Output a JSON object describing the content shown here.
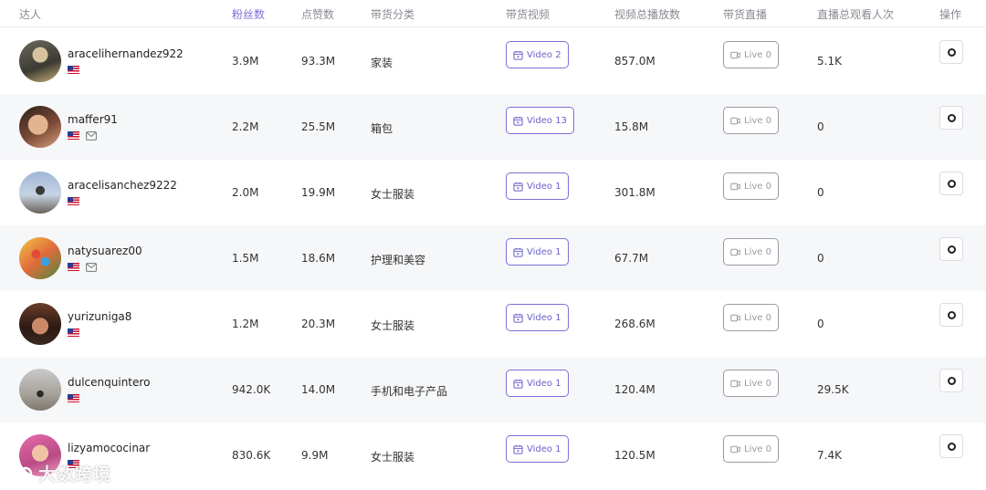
{
  "header": {
    "col_creator": "达人",
    "col_followers": "粉丝数",
    "col_likes": "点赞数",
    "col_category": "带货分类",
    "col_videos": "带货视频",
    "col_video_views": "视频总播放数",
    "col_live": "带货直播",
    "col_live_viewers": "直播总观看人次",
    "col_actions": "操作"
  },
  "colors": {
    "accent": "#7b6fd6",
    "alt_row": "#f6f7f9",
    "live_border": "#9a9aa4"
  },
  "rows": [
    {
      "username": "aracelihernandez922",
      "flag": "us-flag-icon",
      "has_mail": false,
      "followers": "3.9M",
      "likes": "93.3M",
      "category": "家装",
      "video_label": "Video 2",
      "views": "857.0M",
      "live_label": "Live 0",
      "live_viewers": "5.1K"
    },
    {
      "username": "maffer91",
      "flag": "us-flag-icon",
      "has_mail": true,
      "followers": "2.2M",
      "likes": "25.5M",
      "category": "箱包",
      "video_label": "Video 13",
      "views": "15.8M",
      "live_label": "Live 0",
      "live_viewers": "0"
    },
    {
      "username": "aracelisanchez9222",
      "flag": "us-flag-icon",
      "has_mail": false,
      "followers": "2.0M",
      "likes": "19.9M",
      "category": "女士服装",
      "video_label": "Video 1",
      "views": "301.8M",
      "live_label": "Live 0",
      "live_viewers": "0"
    },
    {
      "username": "natysuarez00",
      "flag": "us-flag-icon",
      "has_mail": true,
      "followers": "1.5M",
      "likes": "18.6M",
      "category": "护理和美容",
      "video_label": "Video 1",
      "views": "67.7M",
      "live_label": "Live 0",
      "live_viewers": "0"
    },
    {
      "username": "yurizuniga8",
      "flag": "us-flag-icon",
      "has_mail": false,
      "followers": "1.2M",
      "likes": "20.3M",
      "category": "女士服装",
      "video_label": "Video 1",
      "views": "268.6M",
      "live_label": "Live 0",
      "live_viewers": "0"
    },
    {
      "username": "dulcenquintero",
      "flag": "us-flag-icon",
      "has_mail": false,
      "followers": "942.0K",
      "likes": "14.0M",
      "category": "手机和电子产品",
      "video_label": "Video 1",
      "views": "120.4M",
      "live_label": "Live 0",
      "live_viewers": "29.5K"
    },
    {
      "username": "lizyamococinar",
      "flag": "us-flag-icon",
      "has_mail": false,
      "followers": "830.6K",
      "likes": "9.9M",
      "category": "女士服装",
      "video_label": "Video 1",
      "views": "120.5M",
      "live_label": "Live 0",
      "live_viewers": "7.4K"
    }
  ],
  "watermark": {
    "text": "大数跨境"
  }
}
